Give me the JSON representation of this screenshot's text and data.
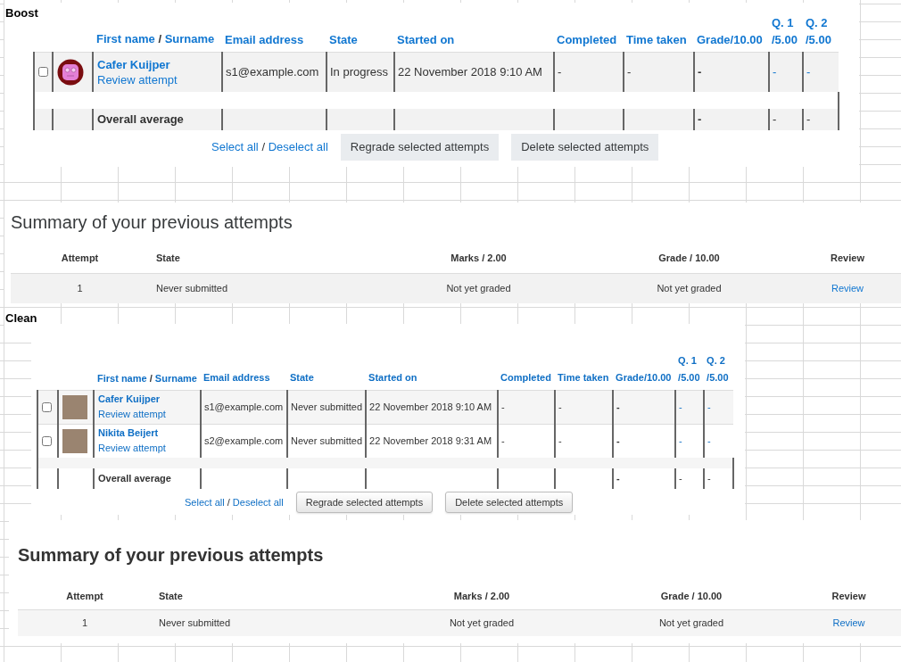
{
  "sections": [
    {
      "label": "Boost",
      "kind": "boost",
      "attempts": {
        "columns": [
          {
            "kind": "check"
          },
          {
            "kind": "avatar"
          },
          {
            "kind": "name",
            "parts": [
              "First name",
              "/",
              "Surname"
            ]
          },
          {
            "kind": "text",
            "lines": [
              "Email address"
            ]
          },
          {
            "kind": "text",
            "lines": [
              "State"
            ]
          },
          {
            "kind": "text",
            "lines": [
              "Started on"
            ]
          },
          {
            "kind": "text",
            "lines": [
              "Completed"
            ]
          },
          {
            "kind": "text",
            "lines": [
              "Time taken"
            ]
          },
          {
            "kind": "text",
            "lines": [
              "Grade/10.00"
            ]
          },
          {
            "kind": "q",
            "lines": [
              "Q. 1",
              "/5.00"
            ]
          },
          {
            "kind": "q",
            "lines": [
              "Q. 2",
              "/5.00"
            ]
          }
        ],
        "rows": [
          {
            "kind": "attempt",
            "checked": false,
            "avatar": {
              "kind": "default"
            },
            "name": "Cafer Kuijper",
            "link": "Review attempt",
            "cells": [
              "s1@example.com",
              "In progress",
              "22 November 2018 9:10 AM",
              "-",
              "-",
              "-",
              "-",
              "-"
            ]
          },
          {
            "kind": "spacer"
          },
          {
            "kind": "average",
            "label": "Overall average",
            "cells": [
              "",
              "",
              "",
              "",
              "",
              "-",
              "-",
              "-"
            ]
          }
        ],
        "select_all": "Select all",
        "separator": "/",
        "deselect_all": "Deselect all",
        "buttons": [
          "Regrade selected attempts",
          "Delete selected attempts"
        ]
      },
      "summary": {
        "title": "Summary of your previous attempts",
        "columns": [
          "Attempt",
          "State",
          "Marks / 2.00",
          "Grade / 10.00",
          "Review"
        ],
        "rows": [
          {
            "attempt": "1",
            "state": "Never submitted",
            "marks": "Not yet graded",
            "grade": "Not yet graded",
            "review": "Review"
          }
        ]
      }
    },
    {
      "label": "Clean",
      "kind": "clean",
      "attempts": {
        "columns": [
          {
            "kind": "check"
          },
          {
            "kind": "avatar"
          },
          {
            "kind": "name",
            "parts": [
              "First name",
              "/",
              "Surname"
            ]
          },
          {
            "kind": "text",
            "lines": [
              "Email address"
            ]
          },
          {
            "kind": "text",
            "lines": [
              "State"
            ]
          },
          {
            "kind": "text",
            "lines": [
              "Started on"
            ]
          },
          {
            "kind": "text",
            "lines": [
              "Completed"
            ]
          },
          {
            "kind": "text",
            "lines": [
              "Time taken"
            ]
          },
          {
            "kind": "text",
            "lines": [
              "Grade/10.00"
            ]
          },
          {
            "kind": "q",
            "lines": [
              "Q. 1",
              "/5.00"
            ]
          },
          {
            "kind": "q",
            "lines": [
              "Q. 2",
              "/5.00"
            ]
          }
        ],
        "rows": [
          {
            "kind": "attempt",
            "checked": false,
            "avatar": {
              "kind": "photo"
            },
            "name": "Cafer Kuijper",
            "link": "Review attempt",
            "cells": [
              "s1@example.com",
              "Never submitted",
              "22 November 2018 9:10 AM",
              "-",
              "-",
              "-",
              "-",
              "-"
            ]
          },
          {
            "kind": "attempt",
            "checked": false,
            "avatar": {
              "kind": "photo"
            },
            "name": "Nikita Beijert",
            "link": "Review attempt",
            "cells": [
              "s2@example.com",
              "Never submitted",
              "22 November 2018 9:31 AM",
              "-",
              "-",
              "-",
              "-",
              "-"
            ]
          },
          {
            "kind": "spacer"
          },
          {
            "kind": "average",
            "label": "Overall average",
            "cells": [
              "",
              "",
              "",
              "",
              "",
              "-",
              "-",
              "-"
            ]
          }
        ],
        "select_all": "Select all",
        "separator": "/",
        "deselect_all": "Deselect all",
        "buttons": [
          "Regrade selected attempts",
          "Delete selected attempts"
        ]
      },
      "summary": {
        "title": "Summary of your previous attempts",
        "columns": [
          "Attempt",
          "State",
          "Marks / 2.00",
          "Grade / 10.00",
          "Review"
        ],
        "rows": [
          {
            "attempt": "1",
            "state": "Never submitted",
            "marks": "Not yet graded",
            "grade": "Not yet graded",
            "review": "Review"
          }
        ]
      }
    }
  ]
}
